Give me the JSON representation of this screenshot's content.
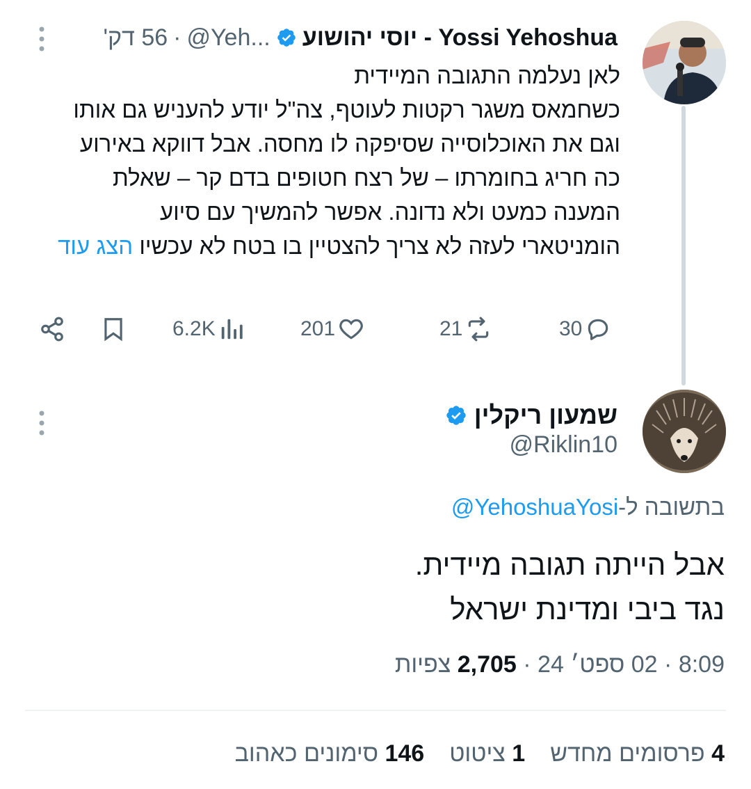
{
  "tweet1": {
    "author_name": "Yossi Yehoshua - יוסי יהושוע",
    "handle": "@Yeh...",
    "time": "56 דק'",
    "verified": true,
    "body_lines": [
      "לאן נעלמה התגובה המיידית",
      "כשחמאס משגר רקטות לעוטף, צה\"ל יודע להעניש גם אותו",
      "וגם את האוכלוסייה שסיפקה לו מחסה. אבל דווקא באירוע",
      "כה חריג בחומרתו – של רצח חטופים בדם קר – שאלת",
      "המענה כמעט ולא נדונה. אפשר להמשיך עם סיוע",
      "הומניטארי לעזה  לא צריך להצטיין בו בטח לא עכשיו"
    ],
    "show_more": "הצג עוד",
    "actions": {
      "replies": "30",
      "reposts": "21",
      "likes": "201",
      "views": "6.2K"
    }
  },
  "tweet2": {
    "author_name": "שמעון ריקלין",
    "handle": "@Riklin10",
    "verified": true,
    "reply_prefix": "בתשובה ל-",
    "reply_mention": "@YehoshuaYosi",
    "body_lines": [
      "אבל הייתה תגובה מיידית.",
      "נגד ביבי ומדינת ישראל"
    ],
    "time": "8:09",
    "date": "02 ספט׳ 24",
    "views_count": "2,705",
    "views_label": "צפיות",
    "stats": {
      "reposts_count": "4",
      "reposts_label": "פרסומים מחדש",
      "quotes_count": "1",
      "quotes_label": "ציטוט",
      "likes_count": "146",
      "likes_label": "סימונים כאהוב"
    }
  },
  "colors": {
    "verified": "#1d9bf0",
    "link": "#1d9bf0",
    "secondary_text": "#536471",
    "thread_line": "#cfd9de"
  }
}
